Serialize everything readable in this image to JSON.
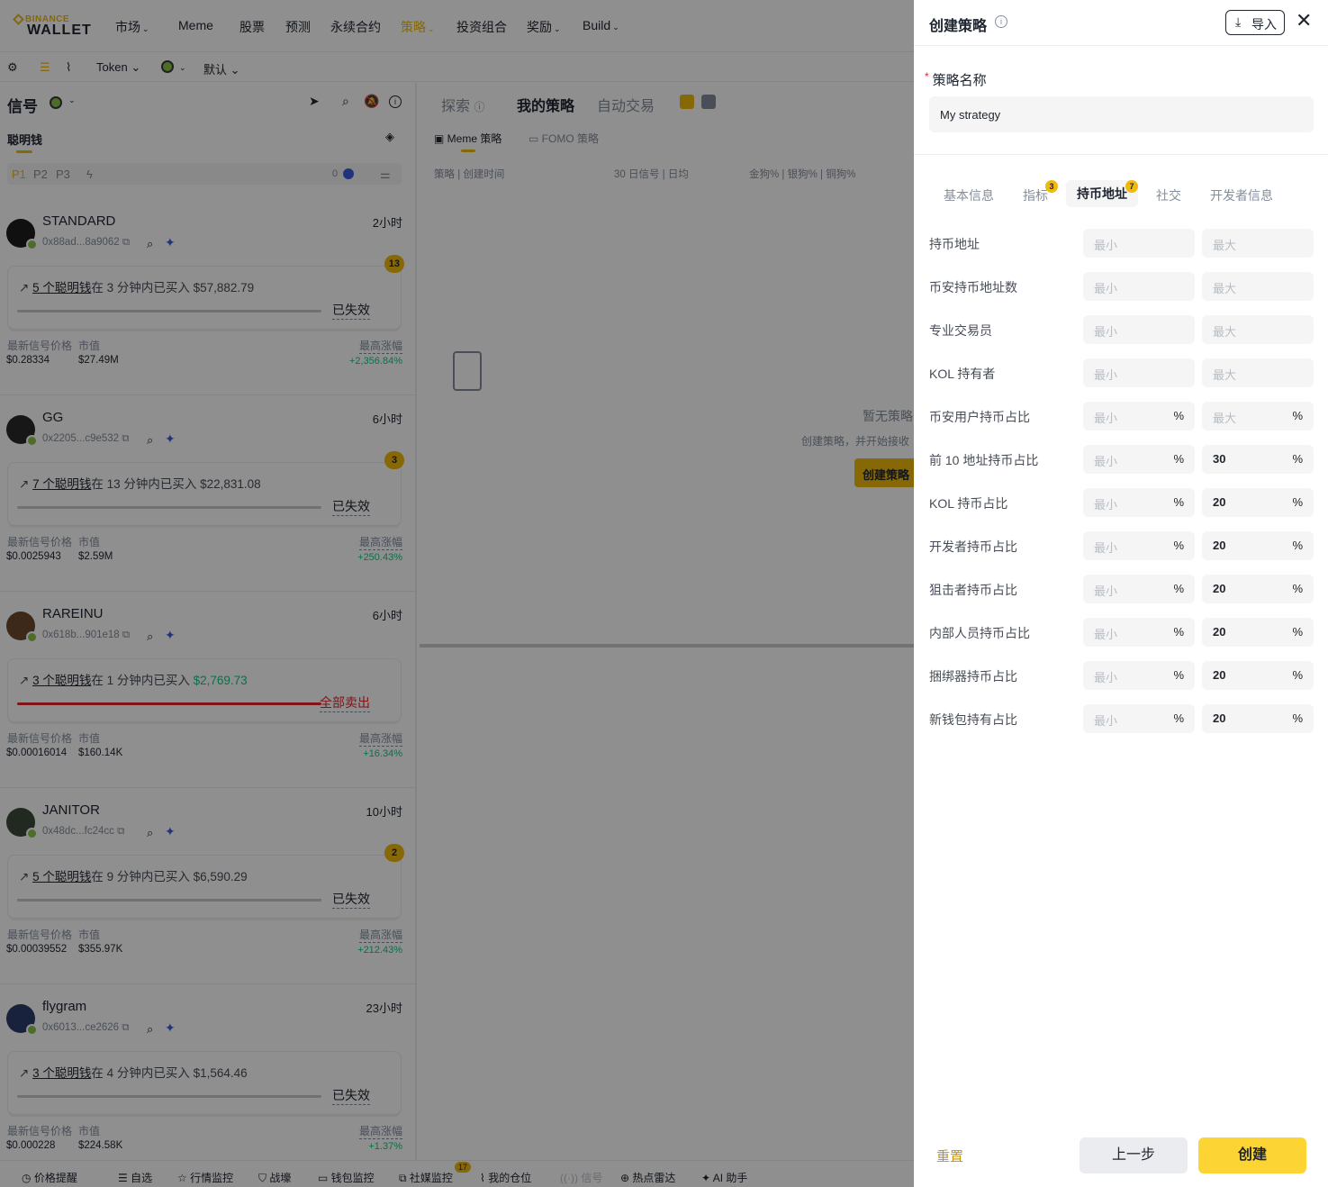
{
  "topnav": {
    "logo_top": "BINANCE",
    "logo_bottom": "WALLET",
    "items": [
      {
        "label": "市场",
        "dropdown": true
      },
      {
        "label": "Meme",
        "dropdown": false
      },
      {
        "label": "股票",
        "dropdown": false
      },
      {
        "label": "预测",
        "dropdown": false
      },
      {
        "label": "永续合约",
        "dropdown": false
      },
      {
        "label": "策略",
        "dropdown": true,
        "active": true
      },
      {
        "label": "投资组合",
        "dropdown": false
      },
      {
        "label": "奖励",
        "dropdown": true
      },
      {
        "label": "Build",
        "dropdown": true
      }
    ]
  },
  "toolbar": {
    "token_label": "Token",
    "default_label": "默认"
  },
  "signals": {
    "title": "信号",
    "tab_label": "聪明钱",
    "page_tabs": [
      "P1",
      "P2",
      "P3"
    ],
    "filter_count": "0",
    "metric_labels": {
      "price": "最新信号价格",
      "mcap": "市值",
      "max_gain": "最高涨幅"
    },
    "cards": [
      {
        "name": "STANDARD",
        "address": "0x88ad...8a9062",
        "time": "2小时",
        "badge": "13",
        "signal_link": "5 个聪明钱",
        "signal_suffix": "在  3 分钟内已买入",
        "amount": "$57,882.79",
        "amount_green": false,
        "status": "已失效",
        "status_red": false,
        "price": "$0.28334",
        "mcap": "$27.49M",
        "max_gain": "+2,356.84%"
      },
      {
        "name": "GG",
        "address": "0x2205...c9e532",
        "time": "6小时",
        "badge": "3",
        "signal_link": "7 个聪明钱",
        "signal_suffix": "在  13 分钟内已买入",
        "amount": "$22,831.08",
        "amount_green": false,
        "status": "已失效",
        "status_red": false,
        "price": "$0.0025943",
        "mcap": "$2.59M",
        "max_gain": "+250.43%"
      },
      {
        "name": "RAREINU",
        "address": "0x618b...901e18",
        "time": "6小时",
        "badge": "",
        "signal_link": "3 个聪明钱",
        "signal_suffix": "在  1 分钟内已买入",
        "amount": "$2,769.73",
        "amount_green": true,
        "status": "全部卖出",
        "status_red": true,
        "price": "$0.00016014",
        "mcap": "$160.14K",
        "max_gain": "+16.34%"
      },
      {
        "name": "JANITOR",
        "address": "0x48dc...fc24cc",
        "time": "10小时",
        "badge": "2",
        "signal_link": "5 个聪明钱",
        "signal_suffix": "在  9 分钟内已买入",
        "amount": "$6,590.29",
        "amount_green": false,
        "status": "已失效",
        "status_red": false,
        "price": "$0.00039552",
        "mcap": "$355.97K",
        "max_gain": "+212.43%"
      },
      {
        "name": "flygram",
        "address": "0x6013...ce2626",
        "time": "23小时",
        "badge": "",
        "signal_link": "3 个聪明钱",
        "signal_suffix": "在  4 分钟内已买入",
        "amount": "$1,564.46",
        "amount_green": false,
        "status": "已失效",
        "status_red": false,
        "price": "$0.000228",
        "mcap": "$224.58K",
        "max_gain": "+1.37%"
      }
    ]
  },
  "strategies": {
    "tabs": [
      "探索",
      "我的策略",
      "自动交易"
    ],
    "sub_tabs": [
      "Meme 策略",
      "FOMO 策略"
    ],
    "headers": {
      "strategy": "策略 | 创建时间",
      "signals": "30 日信号 | 日均",
      "dogs": "金狗% | 银狗% | 铜狗%"
    },
    "empty_title": "暂无策略",
    "empty_desc": "创建策略，并开始接收",
    "empty_btn": "创建策略"
  },
  "bottombar": {
    "items": [
      "价格提醒",
      "自选",
      "行情监控",
      "战壕",
      "钱包监控",
      "社媒监控",
      "我的仓位",
      "信号",
      "热点雷达",
      "AI 助手"
    ],
    "social_badge": "17"
  },
  "drawer": {
    "title": "创建策略",
    "import_label": "导入",
    "name_label": "策略名称",
    "name_value": "My strategy",
    "tabs": [
      {
        "label": "基本信息",
        "badge": ""
      },
      {
        "label": "指标",
        "badge": "3"
      },
      {
        "label": "持币地址",
        "badge": "7",
        "active": true
      },
      {
        "label": "社交",
        "badge": ""
      },
      {
        "label": "开发者信息",
        "badge": ""
      }
    ],
    "min_placeholder": "最小",
    "max_placeholder": "最大",
    "rows": [
      {
        "label": "持币地址",
        "pct": false,
        "max": ""
      },
      {
        "label": "币安持币地址数",
        "pct": false,
        "max": ""
      },
      {
        "label": "专业交易员",
        "pct": false,
        "max": ""
      },
      {
        "label": "KOL 持有者",
        "pct": false,
        "max": ""
      },
      {
        "label": "币安用户持币占比",
        "pct": true,
        "max": ""
      },
      {
        "label": "前 10 地址持币占比",
        "pct": true,
        "max": "30"
      },
      {
        "label": "KOL 持币占比",
        "pct": true,
        "max": "20"
      },
      {
        "label": "开发者持币占比",
        "pct": true,
        "max": "20"
      },
      {
        "label": "狙击者持币占比",
        "pct": true,
        "max": "20"
      },
      {
        "label": "内部人员持币占比",
        "pct": true,
        "max": "20"
      },
      {
        "label": "捆绑器持币占比",
        "pct": true,
        "max": "20"
      },
      {
        "label": "新钱包持有占比",
        "pct": true,
        "max": "20"
      }
    ],
    "pct_symbol": "%",
    "reset_label": "重置",
    "prev_label": "上一步",
    "create_label": "创建"
  }
}
